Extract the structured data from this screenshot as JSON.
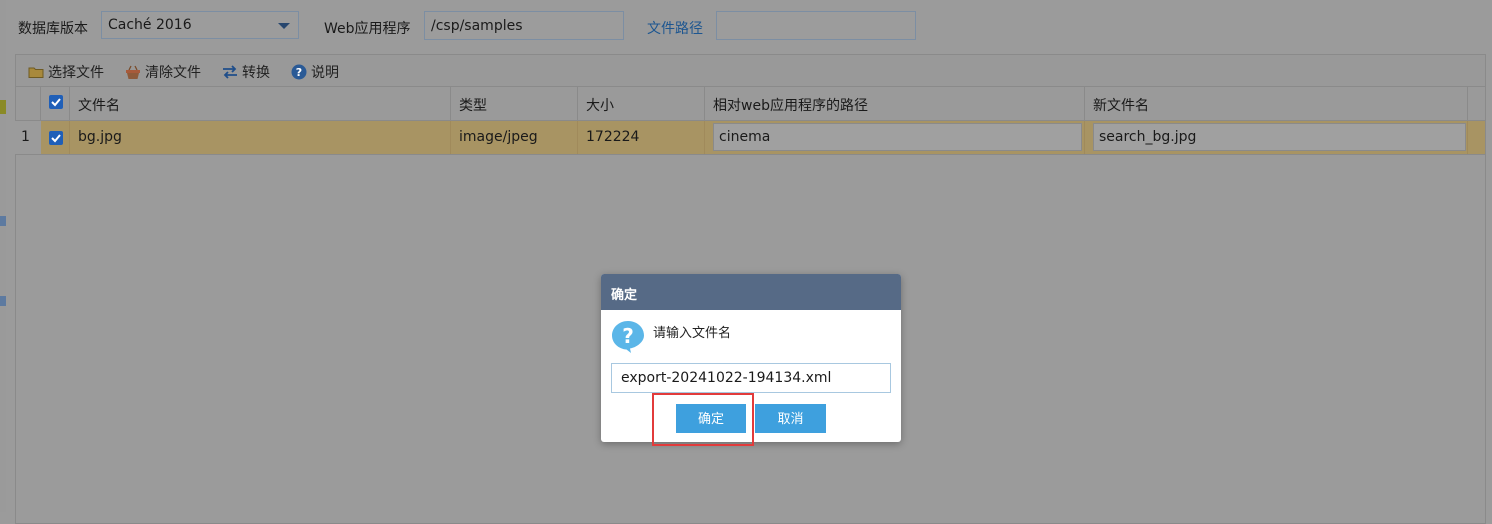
{
  "form": {
    "db_version_label": "数据库版本",
    "db_version_value": "Caché 2016",
    "web_app_label": "Web应用程序",
    "web_app_value": "/csp/samples",
    "file_path_label": "文件路径",
    "file_path_value": ""
  },
  "toolbar": {
    "select_file": "选择文件",
    "clear_file": "清除文件",
    "convert": "转换",
    "help": "说明"
  },
  "grid": {
    "columns": [
      "文件名",
      "类型",
      "大小",
      "相对web应用程序的路径",
      "新文件名"
    ],
    "rows": [
      {
        "index": "1",
        "filename": "bg.jpg",
        "type": "image/jpeg",
        "size": "172224",
        "relative_path": "cinema",
        "new_filename": "search_bg.jpg"
      }
    ]
  },
  "dialog": {
    "title": "确定",
    "message": "请输入文件名",
    "input_value": "export-20241022-194134.xml",
    "ok_label": "确定",
    "cancel_label": "取消"
  },
  "colors": {
    "overlay": "#9b9b9b",
    "selected_row": "#a89463",
    "dialog_header": "#566a86",
    "button": "#3ea0de",
    "highlight": "#e23b3b"
  }
}
